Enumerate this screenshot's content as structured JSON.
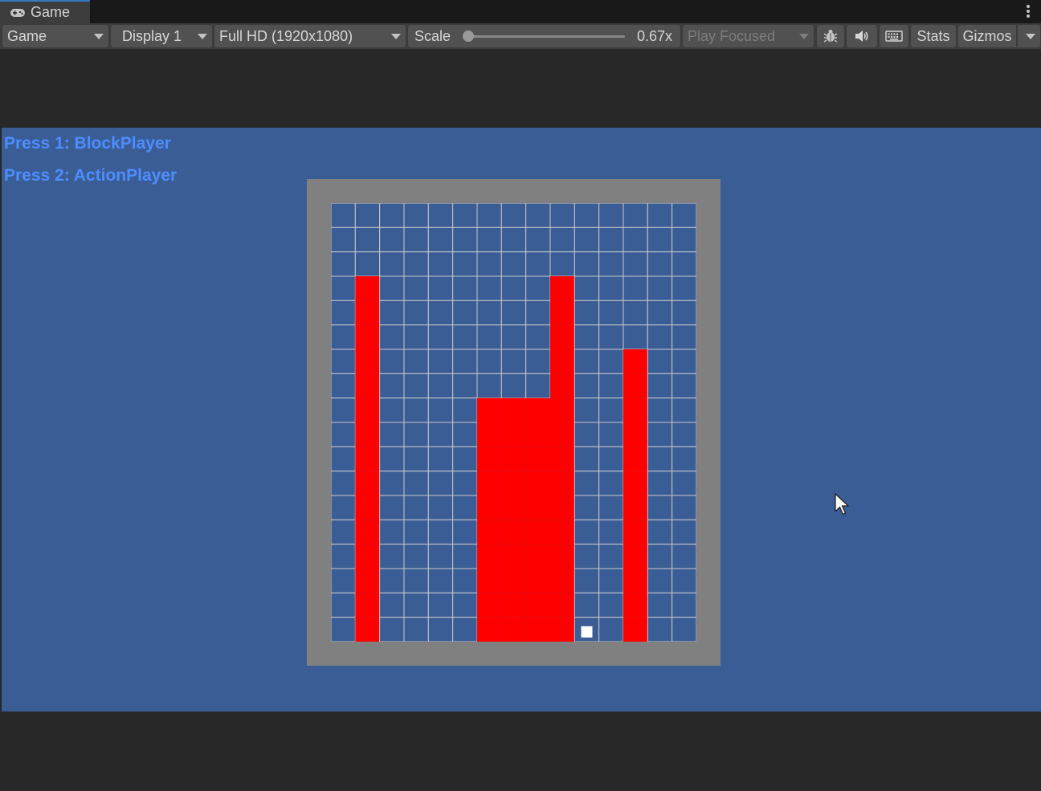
{
  "tab": {
    "icon": "gamepad-icon",
    "label": "Game"
  },
  "toolbar": {
    "view_dropdown": "Game",
    "display_dropdown": "Display 1",
    "resolution_dropdown": "Full HD (1920x1080)",
    "scale_label": "Scale",
    "scale_value": "0.67x",
    "play_mode_dropdown": "Play Focused",
    "debug_icon": "bug-icon",
    "audio_icon": "speaker-icon",
    "keyboard_icon": "keyboard-icon",
    "stats_label": "Stats",
    "gizmos_label": "Gizmos"
  },
  "game": {
    "hints": [
      "Press 1: BlockPlayer",
      "Press 2: ActionPlayer"
    ],
    "grid": {
      "columns": 15,
      "rows": 18,
      "column_heights": [
        0,
        15,
        0,
        0,
        0,
        0,
        10,
        10,
        10,
        15,
        0,
        0,
        12,
        0,
        0
      ],
      "player": {
        "column": 10,
        "row_from_bottom": 0
      }
    },
    "colors": {
      "background": "#3b5d96",
      "frame": "#808080",
      "grid_line": "#c8c8c8",
      "block": "#ff0000",
      "player": "#ffffff",
      "hint_text": "#4d8dff"
    }
  }
}
